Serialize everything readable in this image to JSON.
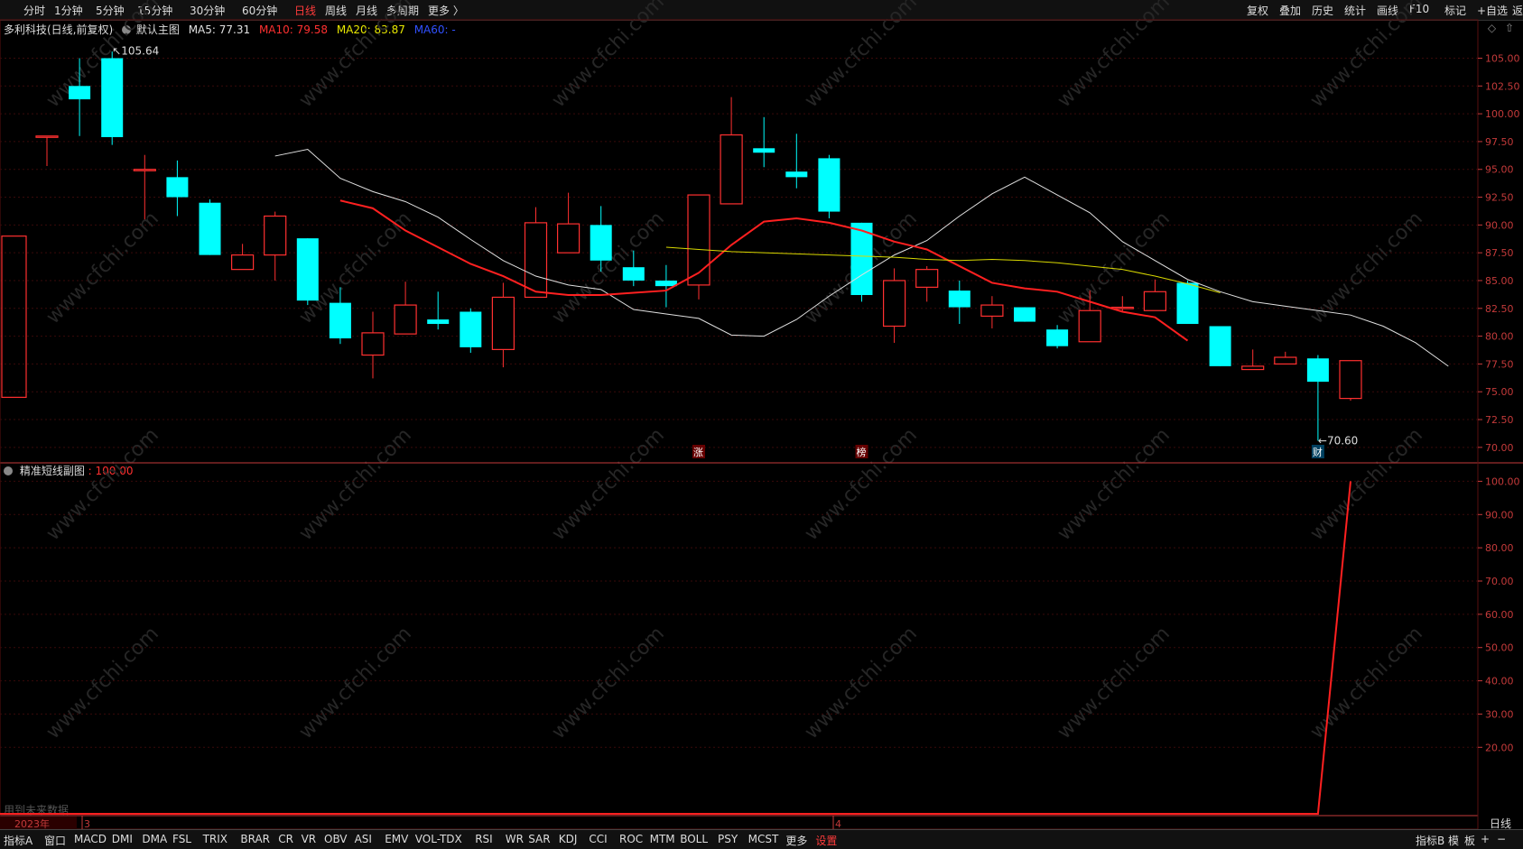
{
  "topbar": {
    "periods": [
      "分时",
      "1分钟",
      "5分钟",
      "15分钟",
      "30分钟",
      "60分钟",
      "日线",
      "周线",
      "月线",
      "多周期",
      "更多 〉"
    ],
    "active_period": "日线",
    "right_tools": [
      "复权",
      "叠加",
      "历史",
      "统计",
      "画线",
      "F10",
      "标记",
      "+自选",
      "返回"
    ]
  },
  "main_legend": {
    "stock": "多利科技(日线,前复权)",
    "template": "默认主图",
    "ma5": "MA5: 77.31",
    "ma10": "MA10: 79.58",
    "ma20": "MA20: 83.87",
    "ma60": "MA60: -"
  },
  "sub_legend": {
    "name": "精准短线副图",
    "value": ": 100.00"
  },
  "annotations": {
    "high_label": "105.64",
    "low_label": "70.60",
    "marker_zhang": "涨",
    "marker_bang": "榜",
    "marker_cai": "财",
    "future_note": "用到未来数据"
  },
  "date_axis": {
    "year": "2023年",
    "m3": "3",
    "m4": "4"
  },
  "bottombar": {
    "items": [
      "指标A",
      "窗口",
      "MACD",
      "DMI",
      "DMA",
      "FSL",
      "TRIX",
      "BRAR",
      "CR",
      "VR",
      "OBV",
      "ASI",
      "EMV",
      "VOL-TDX",
      "RSI",
      "WR",
      "SAR",
      "KDJ",
      "CCI",
      "ROC",
      "MTM",
      "BOLL",
      "PSY",
      "MCST",
      "更多",
      "设置"
    ],
    "active": "设置",
    "right_items": [
      "指标B",
      "模",
      "板",
      "+",
      "−"
    ]
  },
  "right_axis_bottom_label": "日线",
  "watermark": "www.cfchi.com",
  "colors": {
    "up": "#ff3030",
    "down": "#00ffff",
    "ma5": "#e0e0e0",
    "ma10": "#ff2020",
    "ma20": "#d8d800",
    "ma60": "#3050ff",
    "sub_line": "#ff2020",
    "axis": "#c43a3a"
  },
  "chart_data": [
    {
      "type": "candlestick",
      "ylim": [
        69.5,
        106.5
      ],
      "y_ticks": [
        "105.00",
        "102.50",
        "100.00",
        "97.50",
        "95.00",
        "92.50",
        "90.00",
        "87.50",
        "85.00",
        "82.50",
        "80.00",
        "77.50",
        "75.00",
        "72.50",
        "70.00"
      ],
      "candles": [
        {
          "o": 98.0,
          "c": 98.0,
          "h": 98.0,
          "l": 95.3
        },
        {
          "o": 102.5,
          "c": 101.3,
          "h": 105.0,
          "l": 98.0
        },
        {
          "o": 105.0,
          "c": 97.9,
          "h": 105.6,
          "l": 97.2
        },
        {
          "o": 95.0,
          "c": 95.0,
          "h": 96.3,
          "l": 90.5
        },
        {
          "o": 94.3,
          "c": 92.5,
          "h": 95.8,
          "l": 90.8
        },
        {
          "o": 92.0,
          "c": 87.3,
          "h": 92.3,
          "l": 87.3
        },
        {
          "o": 86.0,
          "c": 87.3,
          "h": 88.3,
          "l": 86.0
        },
        {
          "o": 87.3,
          "c": 90.8,
          "h": 91.2,
          "l": 85.0
        },
        {
          "o": 88.8,
          "c": 83.2,
          "h": 88.8,
          "l": 82.8
        },
        {
          "o": 83.0,
          "c": 79.8,
          "h": 84.4,
          "l": 79.3
        },
        {
          "o": 78.3,
          "c": 80.3,
          "h": 82.2,
          "l": 76.2
        },
        {
          "o": 80.2,
          "c": 82.8,
          "h": 84.9,
          "l": 80.2
        },
        {
          "o": 81.5,
          "c": 81.1,
          "h": 84.0,
          "l": 80.6
        },
        {
          "o": 82.2,
          "c": 79.0,
          "h": 82.5,
          "l": 78.5
        },
        {
          "o": 78.8,
          "c": 83.5,
          "h": 84.8,
          "l": 77.2
        },
        {
          "o": 83.5,
          "c": 90.2,
          "h": 91.6,
          "l": 83.5
        },
        {
          "o": 87.5,
          "c": 90.1,
          "h": 92.9,
          "l": 87.5
        },
        {
          "o": 90.0,
          "c": 86.8,
          "h": 91.7,
          "l": 85.8
        },
        {
          "o": 86.2,
          "c": 85.0,
          "h": 87.7,
          "l": 84.5
        },
        {
          "o": 85.0,
          "c": 84.5,
          "h": 86.4,
          "l": 82.6
        },
        {
          "o": 84.6,
          "c": 92.7,
          "h": 92.7,
          "l": 83.3
        },
        {
          "o": 91.9,
          "c": 98.1,
          "h": 101.5,
          "l": 91.9
        },
        {
          "o": 96.9,
          "c": 96.5,
          "h": 99.7,
          "l": 95.2
        },
        {
          "o": 94.8,
          "c": 94.3,
          "h": 98.2,
          "l": 93.3
        },
        {
          "o": 96.0,
          "c": 91.2,
          "h": 96.3,
          "l": 90.6
        },
        {
          "o": 90.2,
          "c": 83.7,
          "h": 90.2,
          "l": 83.1
        },
        {
          "o": 80.9,
          "c": 85.0,
          "h": 86.1,
          "l": 79.4
        },
        {
          "o": 84.4,
          "c": 86.0,
          "h": 86.3,
          "l": 83.1
        },
        {
          "o": 84.1,
          "c": 82.6,
          "h": 85.0,
          "l": 81.1
        },
        {
          "o": 81.8,
          "c": 82.8,
          "h": 83.6,
          "l": 80.7
        },
        {
          "o": 82.6,
          "c": 81.3,
          "h": 82.6,
          "l": 81.3
        },
        {
          "o": 80.6,
          "c": 79.1,
          "h": 81.0,
          "l": 78.9
        },
        {
          "o": 79.5,
          "c": 82.3,
          "h": 84.1,
          "l": 79.5
        },
        {
          "o": 82.5,
          "c": 82.6,
          "h": 83.6,
          "l": 82.2
        },
        {
          "o": 82.3,
          "c": 84.0,
          "h": 85.1,
          "l": 82.3
        },
        {
          "o": 84.8,
          "c": 81.1,
          "h": 85.0,
          "l": 81.1
        },
        {
          "o": 80.9,
          "c": 77.3,
          "h": 80.9,
          "l": 77.3
        },
        {
          "o": 77.0,
          "c": 77.3,
          "h": 78.8,
          "l": 77.0
        },
        {
          "o": 77.5,
          "c": 78.1,
          "h": 78.6,
          "l": 77.5
        },
        {
          "o": 78.0,
          "c": 75.9,
          "h": 78.3,
          "l": 70.6
        },
        {
          "o": 74.4,
          "c": 77.8,
          "h": 77.8,
          "l": 74.2
        }
      ],
      "ma5": [
        null,
        null,
        null,
        null,
        96.2,
        96.8,
        94.2,
        93.0,
        92.1,
        90.7,
        88.7,
        86.8,
        85.4,
        84.6,
        84.2,
        82.4,
        82.0,
        81.6,
        80.1,
        80.0,
        81.5,
        83.6,
        85.5,
        87.3,
        88.6,
        90.8,
        92.8,
        94.3,
        92.7,
        91.1,
        88.5,
        86.8,
        85.1,
        84.0,
        83.1,
        82.7,
        82.3,
        81.9,
        80.9,
        79.4,
        77.3
      ],
      "ma10": [
        null,
        null,
        null,
        null,
        null,
        null,
        null,
        null,
        null,
        92.2,
        91.5,
        89.5,
        88.0,
        86.5,
        85.4,
        84.0,
        83.7,
        83.7,
        83.9,
        84.1,
        85.7,
        88.2,
        90.3,
        90.6,
        90.2,
        89.5,
        88.5,
        87.8,
        86.3,
        84.8,
        84.3,
        84.0,
        83.1,
        82.2,
        81.7,
        79.6
      ],
      "ma20": [
        null,
        null,
        null,
        null,
        null,
        null,
        null,
        null,
        null,
        null,
        null,
        null,
        null,
        null,
        null,
        null,
        null,
        null,
        88.0,
        87.8,
        87.6,
        87.5,
        87.4,
        87.3,
        87.2,
        87.1,
        86.9,
        86.8,
        86.9,
        86.8,
        86.6,
        86.3,
        86.0,
        85.4,
        84.7,
        83.9
      ],
      "ma20_offset": 19,
      "ma10_offset": 9
    },
    {
      "type": "line",
      "name": "精准短线副图",
      "ylim": [
        0,
        105
      ],
      "y_ticks": [
        "100.00",
        "90.00",
        "80.00",
        "70.00",
        "60.00",
        "50.00",
        "40.00",
        "30.00",
        "20.00"
      ],
      "values": [
        0,
        0,
        0,
        0,
        0,
        0,
        0,
        0,
        0,
        0,
        0,
        0,
        0,
        0,
        0,
        0,
        0,
        0,
        0,
        0,
        0,
        0,
        0,
        0,
        0,
        0,
        0,
        0,
        0,
        0,
        0,
        0,
        0,
        0,
        0,
        0,
        0,
        0,
        0,
        0,
        100
      ]
    }
  ]
}
